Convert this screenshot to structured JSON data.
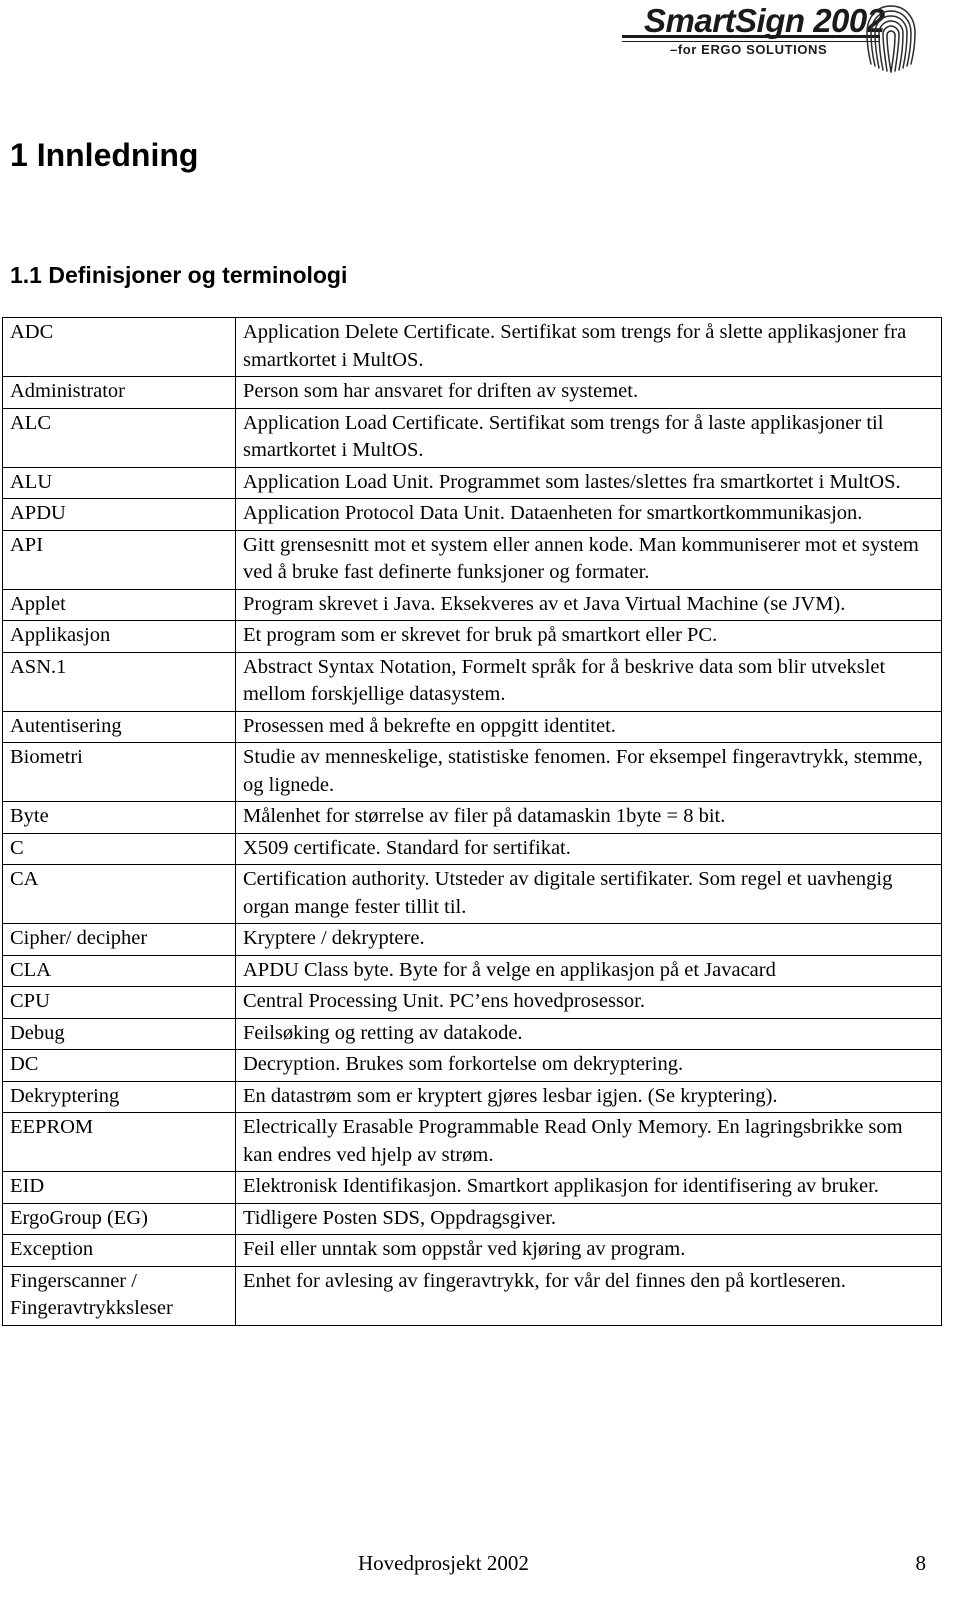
{
  "header": {
    "logo": {
      "wordmark": "SmartSign 2002",
      "tagline": "–for ERGO SOLUTIONS",
      "graphic_name": "fingerprint-icon"
    }
  },
  "headings": {
    "chapter": "1 Innledning",
    "section": "1.1 Definisjoner og terminologi"
  },
  "glossary": {
    "rows": [
      {
        "term": "ADC",
        "definition": "Application Delete Certificate. Sertifikat som trengs for å slette applikasjoner fra smartkortet i MultOS."
      },
      {
        "term": "Administrator",
        "definition": "Person som har ansvaret for driften av systemet."
      },
      {
        "term": "ALC",
        "definition": "Application Load Certificate. Sertifikat som trengs for å laste applikasjoner til smartkortet i MultOS."
      },
      {
        "term": "ALU",
        "definition": "Application Load Unit. Programmet som lastes/slettes fra smartkortet i MultOS."
      },
      {
        "term": "APDU",
        "definition": "Application Protocol Data Unit. Dataenheten for smartkortkommunikasjon."
      },
      {
        "term": "API",
        "definition": "Gitt grensesnitt mot et system eller annen kode. Man kommuniserer mot et system ved å bruke fast definerte funksjoner og formater."
      },
      {
        "term": "Applet",
        "definition": "Program skrevet i Java. Eksekveres av et Java Virtual Machine (se JVM)."
      },
      {
        "term": "Applikasjon",
        "definition": "Et program som er skrevet for bruk på smartkort eller PC."
      },
      {
        "term": "ASN.1",
        "definition": "Abstract Syntax Notation, Formelt språk for å beskrive data som blir utvekslet mellom forskjellige datasystem."
      },
      {
        "term": "Autentisering",
        "definition": "Prosessen med å bekrefte en oppgitt identitet."
      },
      {
        "term": "Biometri",
        "definition": "Studie av menneskelige, statistiske fenomen. For eksempel fingeravtrykk, stemme, og lignede."
      },
      {
        "term": "Byte",
        "definition": "Målenhet for størrelse av filer på datamaskin 1byte = 8 bit."
      },
      {
        "term": "C",
        "definition": "X509 certificate. Standard for sertifikat."
      },
      {
        "term": "CA",
        "definition": "Certification authority. Utsteder av digitale sertifikater. Som regel et uavhengig organ mange fester tillit til."
      },
      {
        "term": "Cipher/ decipher",
        "definition": "Kryptere / dekryptere."
      },
      {
        "term": "CLA",
        "definition": "APDU Class byte. Byte for å velge en applikasjon på et Javacard"
      },
      {
        "term": "CPU",
        "definition": "Central Processing Unit. PC’ens hovedprosessor."
      },
      {
        "term": "Debug",
        "definition": "Feilsøking og retting av datakode."
      },
      {
        "term": "DC",
        "definition": "Decryption. Brukes som forkortelse om dekryptering."
      },
      {
        "term": "Dekryptering",
        "definition": "En datastrøm som er kryptert gjøres lesbar igjen. (Se kryptering)."
      },
      {
        "term": "EEPROM",
        "definition": "Electrically Erasable Programmable Read Only Memory. En lagringsbrikke som kan endres ved hjelp av strøm."
      },
      {
        "term": "EID",
        "definition": "Elektronisk Identifikasjon. Smartkort applikasjon for identifisering av bruker."
      },
      {
        "term": "ErgoGroup (EG)",
        "definition": "Tidligere Posten SDS, Oppdragsgiver."
      },
      {
        "term": "Exception",
        "definition": "Feil eller unntak som oppstår ved kjøring av program."
      },
      {
        "term": "Fingerscanner / Fingeravtrykksleser",
        "definition": "Enhet for avlesing av fingeravtrykk, for vår del finnes den på kortleseren."
      }
    ]
  },
  "footer": {
    "title": "Hovedprosjekt 2002",
    "page_number": "8"
  }
}
